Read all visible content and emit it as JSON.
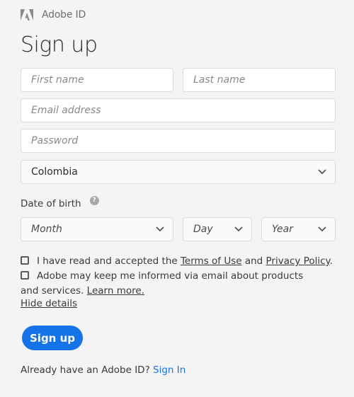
{
  "brand": {
    "logo_icon": "adobe-logo-icon",
    "name": "Adobe ID"
  },
  "title": "Sign up",
  "form": {
    "first_name": {
      "placeholder": "First name",
      "value": ""
    },
    "last_name": {
      "placeholder": "Last name",
      "value": ""
    },
    "email": {
      "placeholder": "Email address",
      "value": ""
    },
    "password": {
      "placeholder": "Password",
      "value": ""
    },
    "country": {
      "selected": "Colombia",
      "icon": "chevron-down-icon"
    },
    "dob": {
      "label": "Date of birth",
      "help_icon": "help-circle-icon",
      "help_glyph": "?",
      "month": {
        "placeholder": "Month"
      },
      "day": {
        "placeholder": "Day"
      },
      "year": {
        "placeholder": "Year"
      }
    },
    "terms": {
      "checked": false,
      "prefix": "I have read and accepted the ",
      "terms_link": "Terms of Use",
      "middle": " and ",
      "privacy_link": "Privacy Policy",
      "suffix": "."
    },
    "marketing": {
      "checked": false,
      "text": "Adobe may keep me informed via email about products and services. ",
      "learn_more": "Learn more."
    },
    "hide_details": "Hide details",
    "submit_label": "Sign up"
  },
  "footer": {
    "prompt": "Already have an Adobe ID? ",
    "sign_in_link": "Sign In"
  },
  "colors": {
    "background": "#f4f4f4",
    "primary": "#1473e6",
    "text": "#2c2c2c"
  }
}
